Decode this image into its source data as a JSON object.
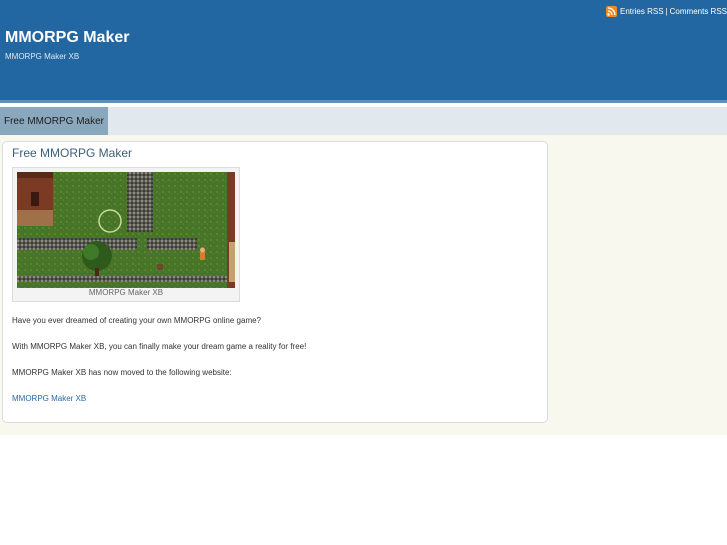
{
  "header": {
    "rss_entries": "Entries RSS",
    "rss_separator": "|",
    "rss_comments": "Comments RSS",
    "site_title": "MMORPG Maker",
    "site_description": "MMORPG Maker XB"
  },
  "nav": {
    "items": [
      {
        "label": "Free MMORPG Maker"
      }
    ]
  },
  "post": {
    "title": "Free MMORPG Maker",
    "image_caption": "MMORPG Maker XB",
    "paragraphs": [
      "Have you ever dreamed of creating your own MMORPG online game?",
      "With MMORPG Maker XB, you can finally make your dream game a reality for free!",
      "MMORPG Maker XB has now moved to the following website:"
    ],
    "link_text": "MMORPG Maker XB"
  },
  "colors": {
    "header": "#2267a1",
    "nav": "#e1e8ee",
    "nav_active": "#8aa8bd",
    "link": "#2a6aa4",
    "rss": "#f08a24"
  }
}
